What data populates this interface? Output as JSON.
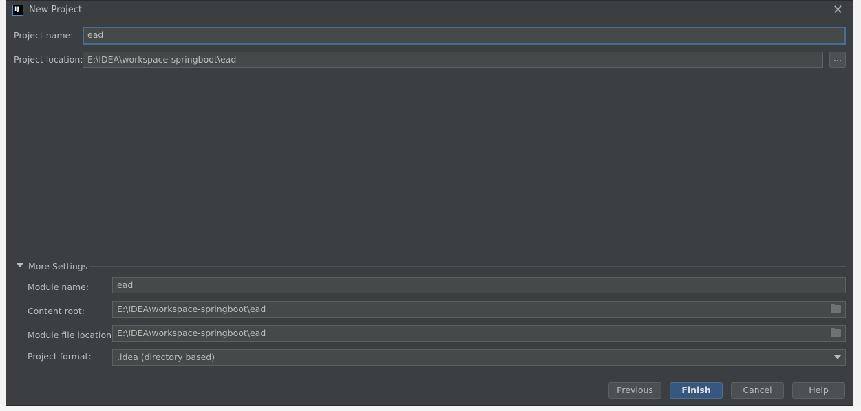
{
  "title": "New Project",
  "project_name": {
    "label": "Project name:",
    "value": "ead"
  },
  "project_location": {
    "label": "Project location:",
    "value": "E:\\IDEA\\workspace-springboot\\ead",
    "browse": "..."
  },
  "more_settings": {
    "label": "More Settings",
    "module_name": {
      "label": "Module name:",
      "value": "ead"
    },
    "content_root": {
      "label": "Content root:",
      "value": "E:\\IDEA\\workspace-springboot\\ead"
    },
    "module_file_location": {
      "label": "Module file location:",
      "value": "E:\\IDEA\\workspace-springboot\\ead"
    },
    "project_format": {
      "label": "Project format:",
      "value": ".idea (directory based)"
    }
  },
  "buttons": {
    "previous": "Previous",
    "finish": "Finish",
    "cancel": "Cancel",
    "help": "Help"
  }
}
